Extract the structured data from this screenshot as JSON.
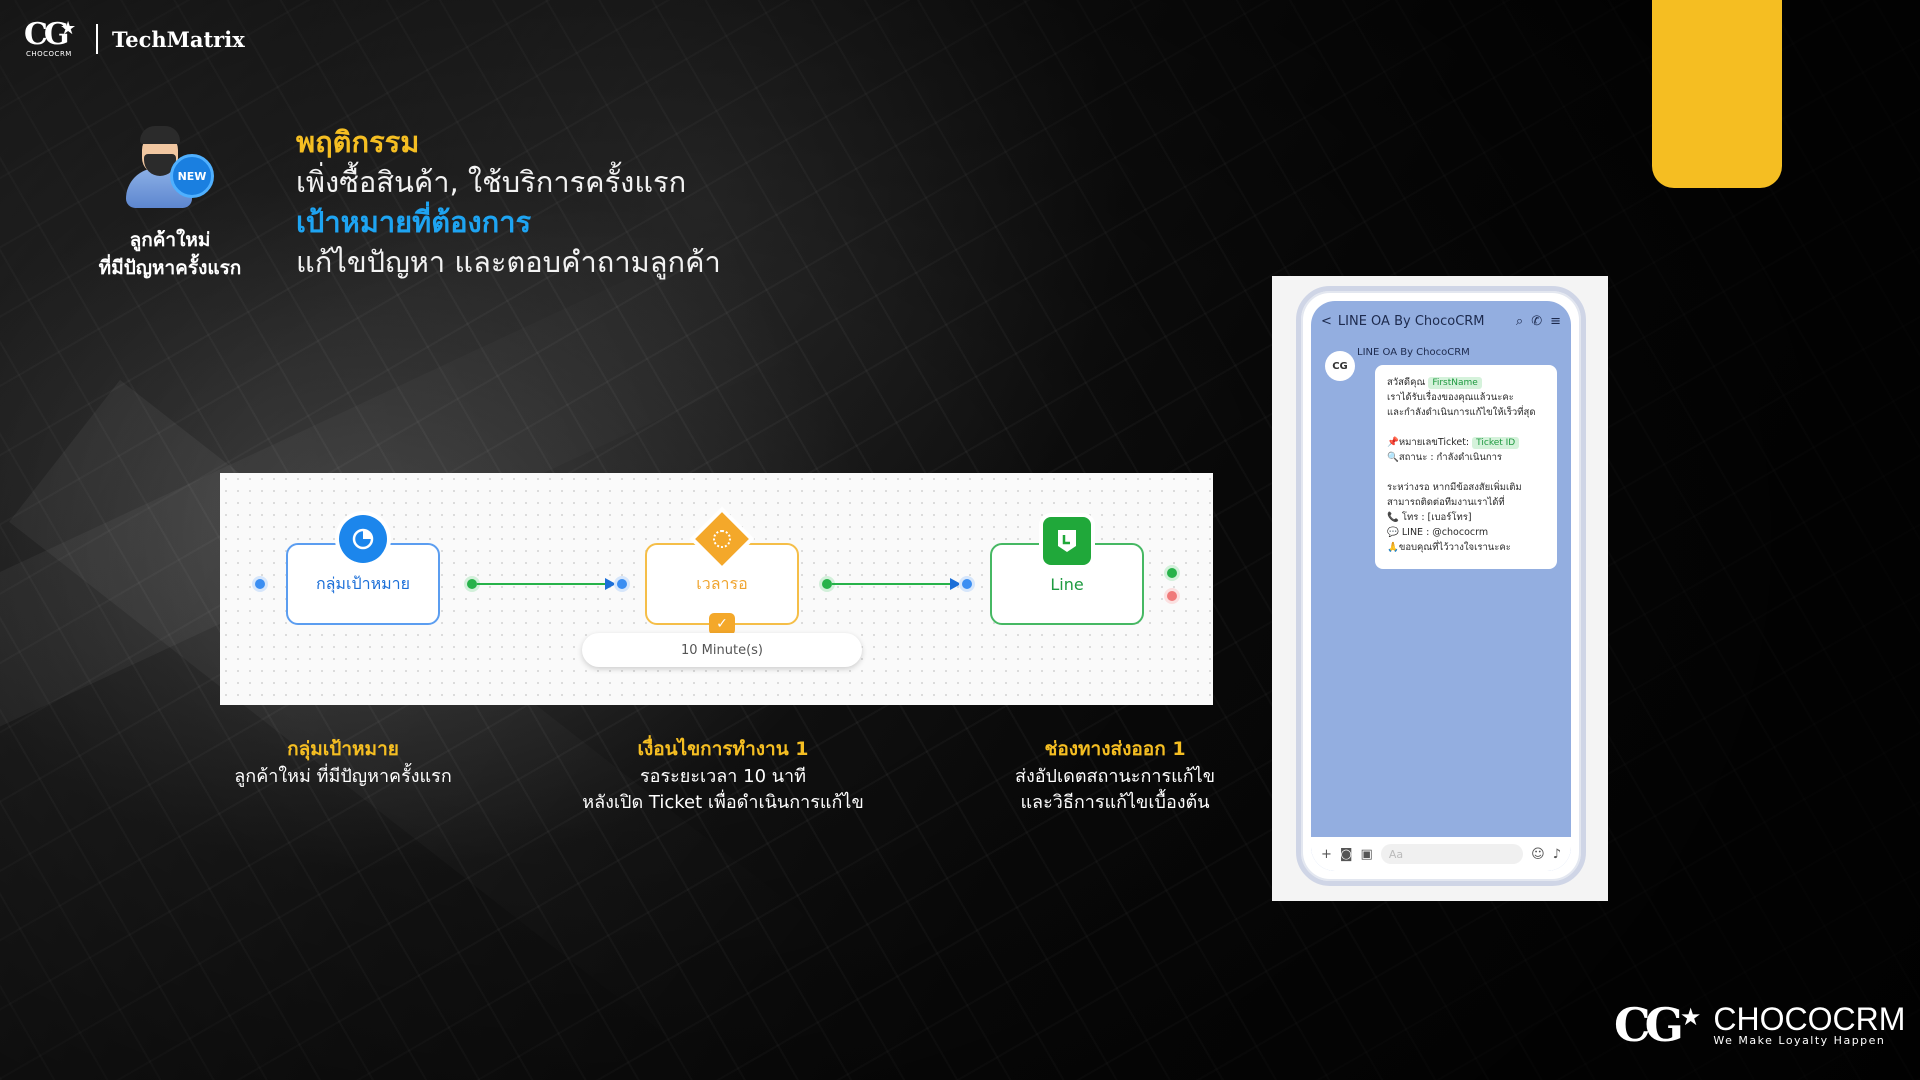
{
  "header": {
    "brand_mini": "CG",
    "brand_mini_sub": "CHOCOCRM",
    "partner": "TechMatrix"
  },
  "persona": {
    "badge": "NEW",
    "caption_line1": "ลูกค้าใหม่",
    "caption_line2": "ที่มีปัญหาครั้งแรก"
  },
  "behavior": {
    "heading": "พฤติกรรม",
    "text": "เพิ่งซื้อสินค้า, ใช้บริการครั้งแรก",
    "goal_heading": "เป้าหมายที่ต้องการ",
    "goal_text": "แก้ไขปัญหา และตอบคำถามลูกค้า"
  },
  "flow": {
    "node1": "กลุ่มเป้าหมาย",
    "node2": "เวลารอ",
    "node3": "Line",
    "wait": "10 Minute(s)"
  },
  "captions": [
    {
      "title": "กลุ่มเป้าหมาย",
      "line1": "ลูกค้าใหม่ ที่มีปัญหาครั้งแรก",
      "line2": ""
    },
    {
      "title": "เงื่อนไขการทำงาน 1",
      "line1": "รอระยะเวลา 10 นาที",
      "line2": "หลังเปิด Ticket เพื่อดำเนินการแก้ไข"
    },
    {
      "title": "ช่องทางส่งออก 1",
      "line1": "ส่งอัปเดตสถานะการแก้ไข",
      "line2": "และวิธีการแก้ไขเบื้องต้น"
    }
  ],
  "phone": {
    "back": "<",
    "title": "LINE OA By ChocoCRM",
    "sender": "LINE OA By ChocoCRM",
    "avatar": "CG",
    "msg_greeting": "สวัสดีคุณ",
    "tag_firstname": "FirstName",
    "msg_l2": "เราได้รับเรื่องของคุณแล้วนะคะ",
    "msg_l3": "และกำลังดำเนินการแก้ไขให้เร็วที่สุด",
    "msg_ticket": "📌หมายเลขTicket:",
    "tag_ticket": "Ticket ID",
    "msg_status": "🔍สถานะ : กำลังดำเนินการ",
    "msg_l6": "ระหว่างรอ หากมีข้อสงสัยเพิ่มเติม",
    "msg_l7": "สามารถติดต่อทีมงานเราได้ที่",
    "msg_tel": "📞 โทร : [เบอร์โทร]",
    "msg_line": "💬 LINE : @chococrm",
    "msg_thanks": "🙏ขอบคุณที่ไว้วางใจเรานะคะ",
    "input_placeholder": "Aa"
  },
  "footer": {
    "logo_mark": "CG",
    "logo_word": "CHOCOCRM",
    "slogan": "We Make Loyalty Happen"
  },
  "colors": {
    "accent_yellow": "#f5be22",
    "accent_blue": "#1ea4f2",
    "line_green": "#20a83a"
  },
  "icons": [
    "star-icon",
    "pie-chart-icon",
    "timer-icon",
    "check-icon",
    "line-icon",
    "search-icon",
    "phone-icon",
    "menu-icon",
    "plus-icon",
    "camera-icon",
    "image-icon",
    "emoji-icon",
    "mic-icon"
  ]
}
